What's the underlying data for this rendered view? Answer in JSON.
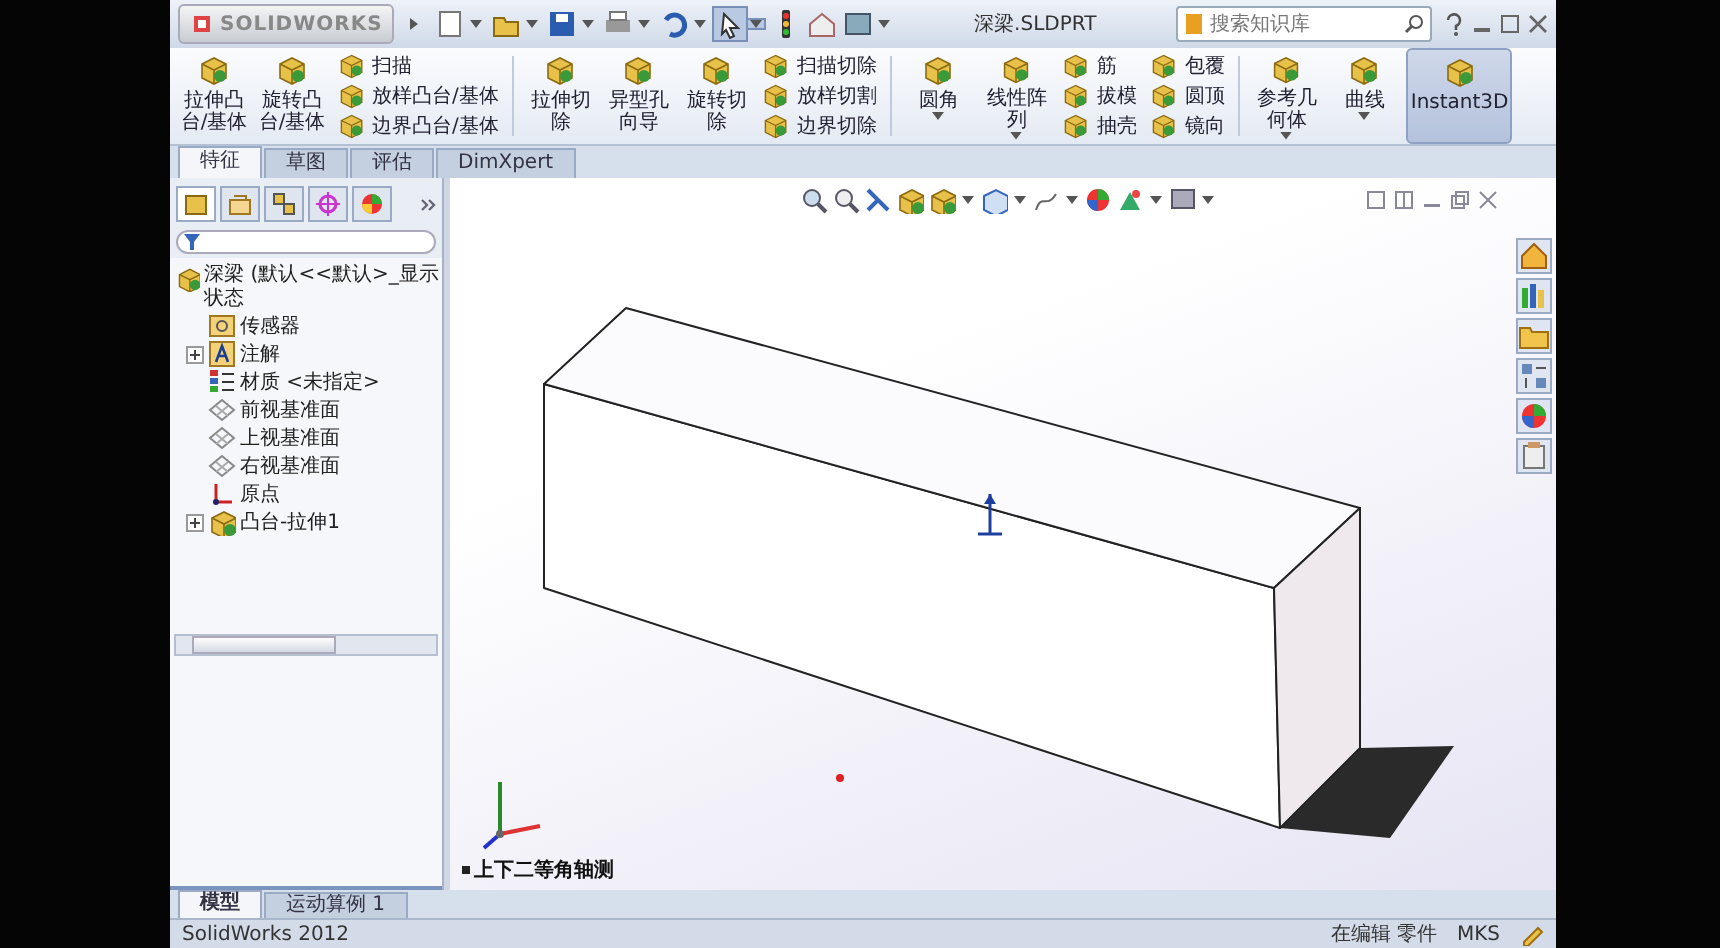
{
  "app": {
    "logo": "SOLIDWORKS",
    "title": "深梁.SLDPRT",
    "search": {
      "placeholder": "搜索知识库"
    }
  },
  "ribbon": [
    {
      "kind": "large",
      "label": "拉伸凸台/基体",
      "dropdown": false,
      "on": false
    },
    {
      "kind": "large",
      "label": "旋转凸台/基体",
      "dropdown": false,
      "on": false
    },
    {
      "kind": "stack",
      "items": [
        "扫描",
        "放样凸台/基体",
        "边界凸台/基体"
      ]
    },
    {
      "kind": "separator"
    },
    {
      "kind": "large",
      "label": "拉伸切除",
      "dropdown": false,
      "on": false
    },
    {
      "kind": "large",
      "label": "异型孔向导",
      "dropdown": false,
      "on": false
    },
    {
      "kind": "large",
      "label": "旋转切除",
      "dropdown": false,
      "on": false
    },
    {
      "kind": "stack",
      "items": [
        "扫描切除",
        "放样切割",
        "边界切除"
      ]
    },
    {
      "kind": "separator"
    },
    {
      "kind": "large",
      "label": "圆角",
      "dropdown": true,
      "on": false
    },
    {
      "kind": "large",
      "label": "线性阵列",
      "dropdown": true,
      "on": false
    },
    {
      "kind": "stack",
      "items": [
        "筋",
        "拔模",
        "抽壳"
      ]
    },
    {
      "kind": "stack",
      "items": [
        "包覆",
        "圆顶",
        "镜向"
      ]
    },
    {
      "kind": "separator"
    },
    {
      "kind": "large",
      "label": "参考几何体",
      "dropdown": true,
      "on": false
    },
    {
      "kind": "large",
      "label": "曲线",
      "dropdown": true,
      "on": false
    },
    {
      "kind": "large",
      "label": "Instant3D",
      "dropdown": false,
      "on": true
    }
  ],
  "tabs": [
    {
      "label": "特征",
      "selected": true
    },
    {
      "label": "草图",
      "selected": false
    },
    {
      "label": "评估",
      "selected": false
    },
    {
      "label": "DimXpert",
      "selected": false
    }
  ],
  "tree": {
    "label": "深梁 (默认<<默认>_显示状态",
    "kind": "part",
    "children": [
      {
        "label": "传感器",
        "kind": "sensor",
        "expander": false
      },
      {
        "label": "注解",
        "kind": "annotation",
        "expander": true
      },
      {
        "label": "材质 <未指定>",
        "kind": "material",
        "expander": false
      },
      {
        "label": "前视基准面",
        "kind": "plane",
        "expander": false
      },
      {
        "label": "上视基准面",
        "kind": "plane",
        "expander": false
      },
      {
        "label": "右视基准面",
        "kind": "plane",
        "expander": false
      },
      {
        "label": "原点",
        "kind": "origin",
        "expander": false
      },
      {
        "label": "凸台-拉伸1",
        "kind": "feature",
        "expander": true
      }
    ]
  },
  "viewport": {
    "view_label": "上下二等角轴测"
  },
  "bottom_tabs": [
    {
      "label": "模型",
      "selected": true
    },
    {
      "label": "运动算例 1",
      "selected": false
    }
  ],
  "status_bar": {
    "product": "SolidWorks 2012",
    "mode": "在编辑 零件",
    "units": "MKS"
  }
}
